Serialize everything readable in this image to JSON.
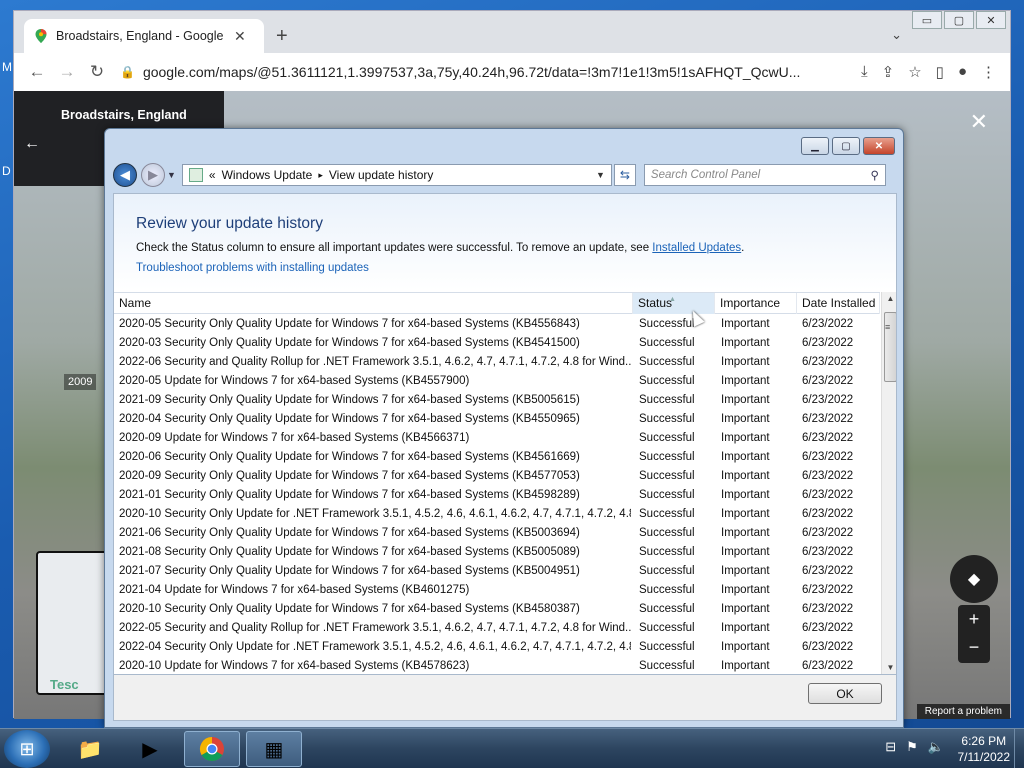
{
  "desktop": {
    "letters": [
      "M",
      "D"
    ]
  },
  "chrome": {
    "tab_title": "Broadstairs, England - Google Maps",
    "tab_close": "✕",
    "new_tab": "+",
    "tab_search": "⌄",
    "url": "google.com/maps/@51.3611121,1.3997537,3a,75y,40.24h,96.72t/data=!3m7!1e1!3m5!1sAFHQT_QcwU...",
    "window_controls": [
      "▭",
      "▢",
      "✕"
    ]
  },
  "maps": {
    "place_title": "Broadstairs, England",
    "year": "2009",
    "report": "Report a problem",
    "minimap_label": "Tesc",
    "close": "✕",
    "back": "←",
    "zoom_in": "+",
    "zoom_out": "−"
  },
  "control_panel": {
    "breadcrumb_prefix": "«",
    "breadcrumb_1": "Windows Update",
    "breadcrumb_sep": "▸",
    "breadcrumb_2": "View update history",
    "search_placeholder": "Search Control Panel",
    "title": "Review your update history",
    "description": "Check the Status column to ensure all important updates were successful. To remove an update, see ",
    "installed_updates_link": "Installed Updates",
    "description_end": ".",
    "troubleshoot_link": "Troubleshoot problems with installing updates",
    "ok_label": "OK",
    "columns": {
      "name": "Name",
      "status": "Status",
      "importance": "Importance",
      "date": "Date Installed"
    },
    "rows": [
      {
        "name": "2020-05 Security Only Quality Update for Windows 7 for x64-based Systems (KB4556843)",
        "status": "Successful",
        "importance": "Important",
        "date": "6/23/2022"
      },
      {
        "name": "2020-03 Security Only Quality Update for Windows 7 for x64-based Systems (KB4541500)",
        "status": "Successful",
        "importance": "Important",
        "date": "6/23/2022"
      },
      {
        "name": "2022-06 Security and Quality Rollup for .NET Framework 3.5.1, 4.6.2, 4.7, 4.7.1, 4.7.2, 4.8 for Wind...",
        "status": "Successful",
        "importance": "Important",
        "date": "6/23/2022"
      },
      {
        "name": "2020-05 Update for Windows 7 for x64-based Systems (KB4557900)",
        "status": "Successful",
        "importance": "Important",
        "date": "6/23/2022"
      },
      {
        "name": "2021-09 Security Only Quality Update for Windows 7 for x64-based Systems (KB5005615)",
        "status": "Successful",
        "importance": "Important",
        "date": "6/23/2022"
      },
      {
        "name": "2020-04 Security Only Quality Update for Windows 7 for x64-based Systems (KB4550965)",
        "status": "Successful",
        "importance": "Important",
        "date": "6/23/2022"
      },
      {
        "name": "2020-09 Update for Windows 7 for x64-based Systems (KB4566371)",
        "status": "Successful",
        "importance": "Important",
        "date": "6/23/2022"
      },
      {
        "name": "2020-06 Security Only Quality Update for Windows 7 for x64-based Systems (KB4561669)",
        "status": "Successful",
        "importance": "Important",
        "date": "6/23/2022"
      },
      {
        "name": "2020-09 Security Only Quality Update for Windows 7 for x64-based Systems (KB4577053)",
        "status": "Successful",
        "importance": "Important",
        "date": "6/23/2022"
      },
      {
        "name": "2021-01 Security Only Quality Update for Windows 7 for x64-based Systems (KB4598289)",
        "status": "Successful",
        "importance": "Important",
        "date": "6/23/2022"
      },
      {
        "name": "2020-10 Security Only Update for .NET Framework 3.5.1, 4.5.2, 4.6, 4.6.1, 4.6.2, 4.7, 4.7.1, 4.7.2, 4.8...",
        "status": "Successful",
        "importance": "Important",
        "date": "6/23/2022"
      },
      {
        "name": "2021-06 Security Only Quality Update for Windows 7 for x64-based Systems (KB5003694)",
        "status": "Successful",
        "importance": "Important",
        "date": "6/23/2022"
      },
      {
        "name": "2021-08 Security Only Quality Update for Windows 7 for x64-based Systems (KB5005089)",
        "status": "Successful",
        "importance": "Important",
        "date": "6/23/2022"
      },
      {
        "name": "2021-07 Security Only Quality Update for Windows 7 for x64-based Systems (KB5004951)",
        "status": "Successful",
        "importance": "Important",
        "date": "6/23/2022"
      },
      {
        "name": "2021-04 Update for Windows 7 for x64-based Systems (KB4601275)",
        "status": "Successful",
        "importance": "Important",
        "date": "6/23/2022"
      },
      {
        "name": "2020-10 Security Only Quality Update for Windows 7 for x64-based Systems (KB4580387)",
        "status": "Successful",
        "importance": "Important",
        "date": "6/23/2022"
      },
      {
        "name": "2022-05 Security and Quality Rollup for .NET Framework 3.5.1, 4.6.2, 4.7, 4.7.1, 4.7.2, 4.8 for Wind...",
        "status": "Successful",
        "importance": "Important",
        "date": "6/23/2022"
      },
      {
        "name": "2022-04 Security Only Update for .NET Framework 3.5.1, 4.5.2, 4.6, 4.6.1, 4.6.2, 4.7, 4.7.1, 4.7.2, 4.8...",
        "status": "Successful",
        "importance": "Important",
        "date": "6/23/2022"
      },
      {
        "name": "2020-10 Update for Windows 7 for x64-based Systems (KB4578623)",
        "status": "Successful",
        "importance": "Important",
        "date": "6/23/2022"
      }
    ]
  },
  "taskbar": {
    "time": "6:26 PM",
    "date": "7/11/2022",
    "icons": [
      "start-orb",
      "explorer",
      "media-player",
      "chrome",
      "control-panel"
    ]
  },
  "colors": {
    "title_blue": "#1e3f79",
    "link_blue": "#1b63b8",
    "sorted_column": "#dceaf7"
  }
}
